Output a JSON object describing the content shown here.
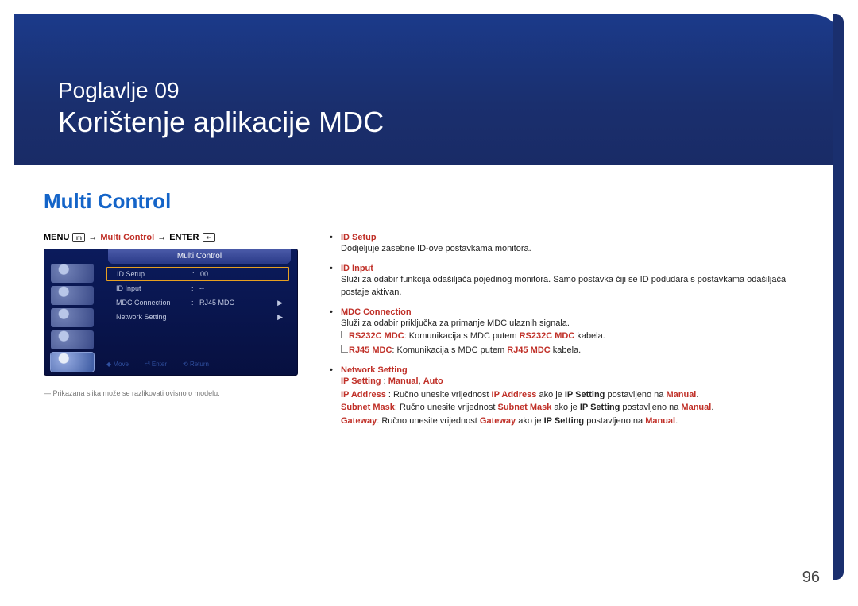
{
  "chapter": {
    "label": "Poglavlje  09",
    "title": "Korištenje aplikacije MDC"
  },
  "section": {
    "title": "Multi Control"
  },
  "breadcrumb": {
    "menu": "MENU",
    "arrow": "→",
    "item": "Multi Control",
    "enter": "ENTER"
  },
  "osd": {
    "title": "Multi Control",
    "rows": [
      {
        "label": "ID Setup",
        "value": "00",
        "arrow": ""
      },
      {
        "label": "ID Input",
        "value": "--",
        "arrow": ""
      },
      {
        "label": "MDC Connection",
        "value": "RJ45 MDC",
        "arrow": "▶"
      },
      {
        "label": "Network Setting",
        "value": "",
        "arrow": "▶"
      }
    ],
    "footer": {
      "move": "Move",
      "enter": "Enter",
      "return": "Return"
    }
  },
  "footnote": "―  Prikazana slika može se razlikovati ovisno o modelu.",
  "items": [
    {
      "head": "ID Setup",
      "body": "Dodjeljuje zasebne ID-ove postavkama monitora."
    },
    {
      "head": "ID Input",
      "body": "Služi za odabir funkcija odašiljača pojedinog monitora. Samo postavka čiji se ID podudara s postavkama odašiljača postaje aktivan."
    },
    {
      "head": "MDC Connection",
      "body": "Služi za odabir priključka za primanje MDC ulaznih signala.",
      "subs": [
        {
          "b1": "RS232C MDC",
          "t1": ": Komunikacija s MDC putem ",
          "b2": "RS232C MDC",
          "t2": " kabela."
        },
        {
          "b1": "RJ45 MDC",
          "t1": ": Komunikacija s MDC putem ",
          "b2": "RJ45 MDC",
          "t2": " kabela."
        }
      ]
    },
    {
      "head": "Network Setting",
      "ipsetting_label": "IP Setting",
      "ipsetting_sep": " : ",
      "ipsetting_v1": "Manual",
      "ipsetting_sep2": ", ",
      "ipsetting_v2": "Auto",
      "lines": [
        {
          "k": "IP Address",
          "t1": " : Ručno unesite vrijednost ",
          "k2": "IP Address",
          "t2": " ako je ",
          "k3": "IP Setting",
          "t3": " postavljeno na ",
          "k4": "Manual",
          "t4": "."
        },
        {
          "k": "Subnet Mask",
          "t1": ": Ručno unesite vrijednost ",
          "k2": "Subnet Mask",
          "t2": " ako je ",
          "k3": "IP Setting",
          "t3": " postavljeno na ",
          "k4": "Manual",
          "t4": "."
        },
        {
          "k": "Gateway",
          "t1": ": Ručno unesite vrijednost ",
          "k2": "Gateway",
          "t2": " ako je ",
          "k3": "IP Setting",
          "t3": " postavljeno na ",
          "k4": "Manual",
          "t4": "."
        }
      ]
    }
  ],
  "pageNumber": "96"
}
